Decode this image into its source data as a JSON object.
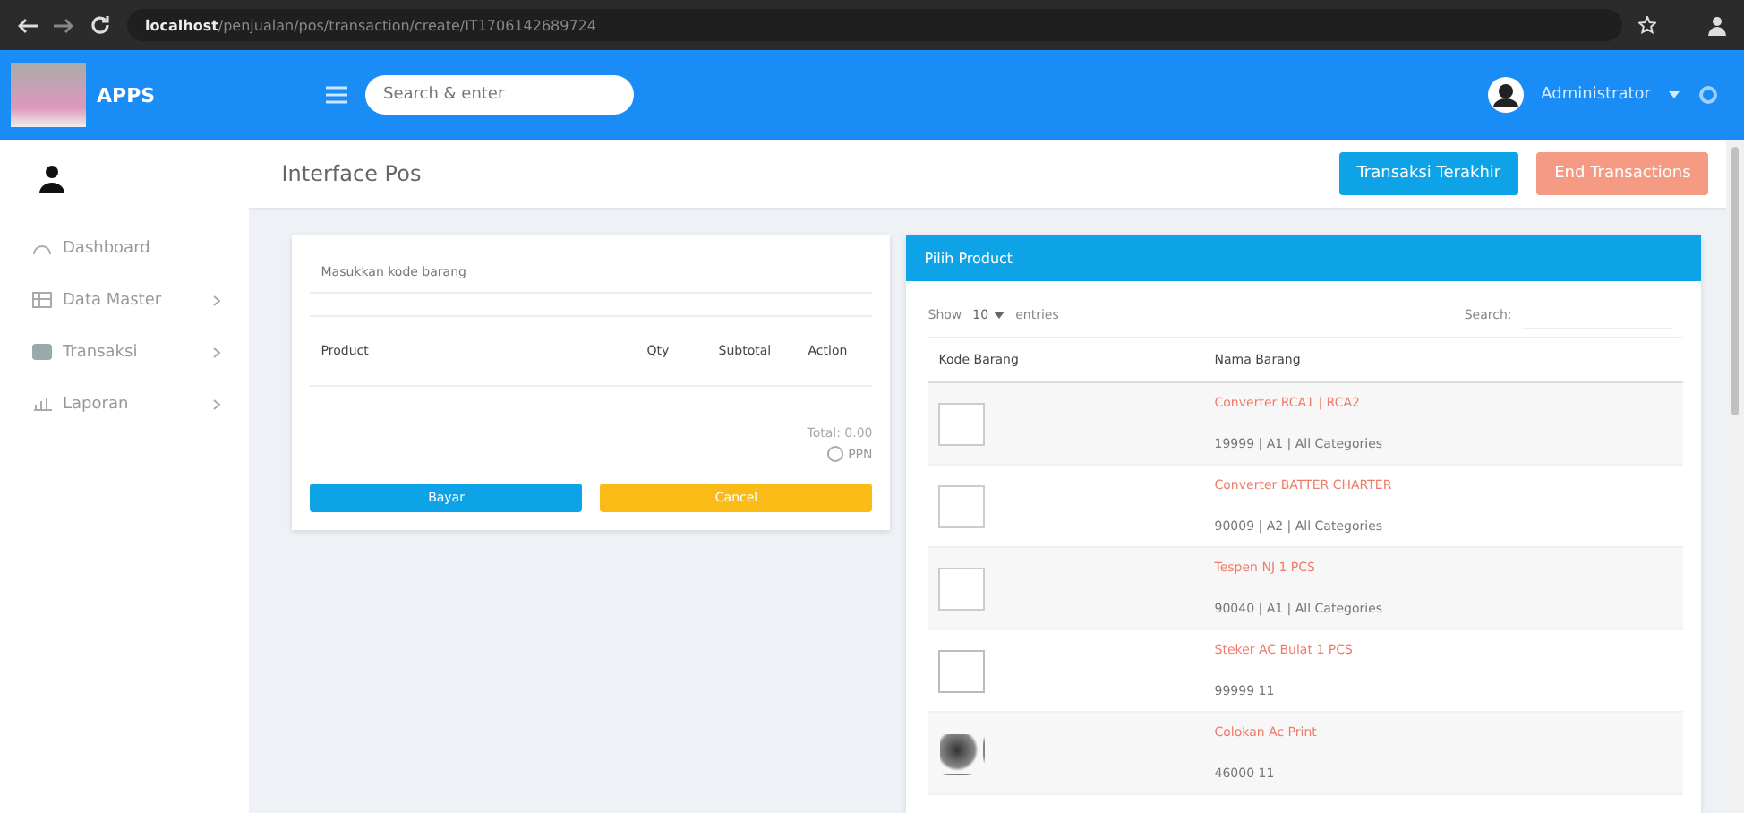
{
  "browser": {
    "url_host": "localhost",
    "url_path": "/penjualan/pos/transaction/create/IT1706142689724"
  },
  "header": {
    "brand": "APPS",
    "search": {
      "placeholder": "Search & enter"
    },
    "user": "Administrator"
  },
  "sidebar": {
    "items": [
      {
        "label": "Dashboard",
        "has_children": false
      },
      {
        "label": "Data Master",
        "has_children": true
      },
      {
        "label": "Transaksi",
        "has_children": true
      },
      {
        "label": "Laporan",
        "has_children": true
      }
    ]
  },
  "page": {
    "title": "Interface Pos",
    "buttons": [
      {
        "label": "Transaksi Terakhir",
        "kind": "info"
      },
      {
        "label": "End Transactions",
        "kind": "danger"
      }
    ]
  },
  "cart": {
    "barcode": {
      "placeholder": "Masukkan kode barang"
    },
    "columns": [
      "Product",
      "Qty",
      "Subtotal",
      "Action"
    ],
    "total": "Total: 0.00",
    "ppn": {
      "label": "PPN",
      "checked": false
    },
    "buttons": [
      {
        "label": "Bayar",
        "kind": "pay"
      },
      {
        "label": "Cancel",
        "kind": "cancel"
      }
    ]
  },
  "products": {
    "title": "Pilih Product",
    "show": "Show",
    "page_size": "10",
    "entries": "entries",
    "search_label": "Search:",
    "columns": [
      "Kode Barang",
      "Nama Barang"
    ],
    "rows": [
      {
        "name": "Converter RCA1 | RCA2",
        "detail": "19999 | A1 | All Categories",
        "kind": "broken"
      },
      {
        "name": "Converter BATTER CHARTER",
        "detail": "90009 | A2 | All Categories",
        "kind": "broken"
      },
      {
        "name": "Tespen NJ 1 PCS",
        "detail": "90040 | A1 | All Categories",
        "kind": "broken"
      },
      {
        "name": "Steker AC Bulat 1 PCS",
        "detail": "99999 11",
        "kind": "empty"
      },
      {
        "name": "Colokan Ac Print",
        "detail": "46000 11",
        "kind": "photo"
      }
    ]
  }
}
